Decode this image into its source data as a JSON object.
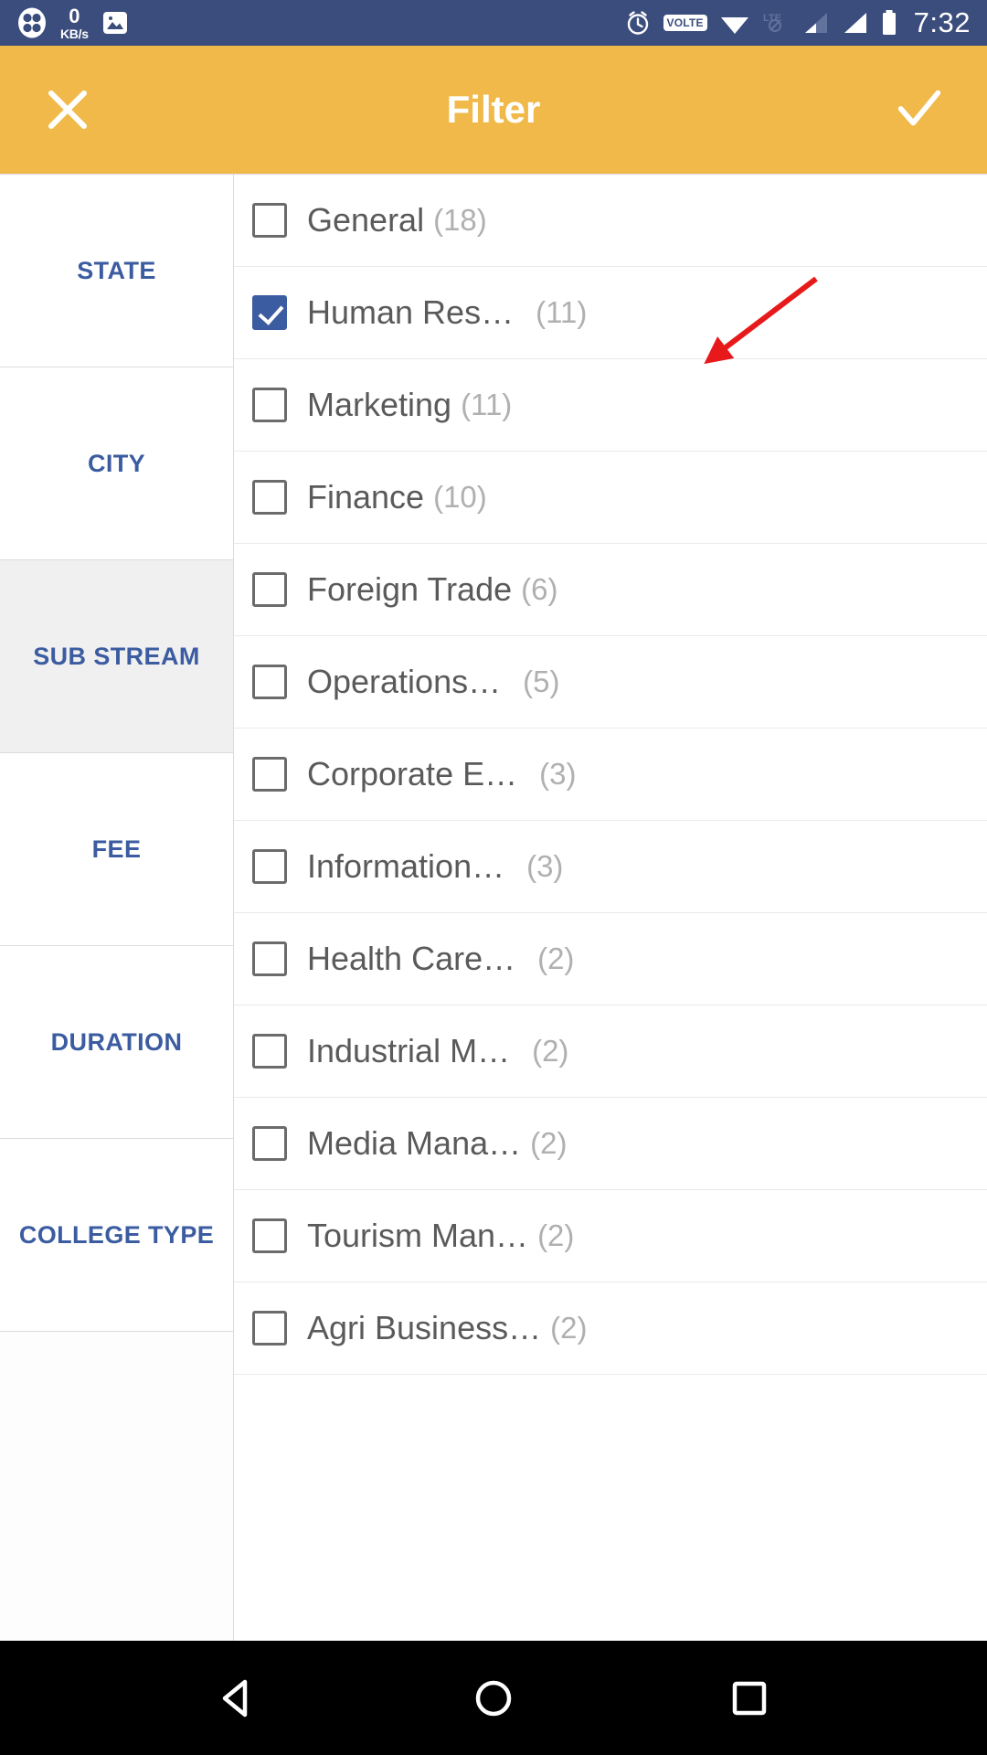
{
  "statusbar": {
    "network_speed_value": "0",
    "network_speed_unit": "KB/s",
    "volte_label": "VOLTE",
    "lte_label": "LTE",
    "time": "7:32",
    "icons": [
      "clover-icon",
      "image-icon",
      "alarm-icon",
      "volte-icon",
      "wifi-icon",
      "lte-disabled-icon",
      "signal-icon-1",
      "signal-icon-2",
      "battery-icon"
    ]
  },
  "appbar": {
    "title": "Filter",
    "close_label": "Close",
    "apply_label": "Apply",
    "background_color": "#f0b94a"
  },
  "sidebar": {
    "selected_index": 2,
    "items": [
      {
        "label": "STATE"
      },
      {
        "label": "CITY"
      },
      {
        "label": "SUB STREAM"
      },
      {
        "label": "FEE"
      },
      {
        "label": "DURATION"
      },
      {
        "label": "COLLEGE TYPE"
      }
    ],
    "accent_color": "#3b5ca0",
    "selected_background": "#f0f0f0"
  },
  "filter_list": {
    "rows": [
      {
        "label": "General",
        "count": "(18)",
        "checked": false,
        "wide_gap": false
      },
      {
        "label": "Human Res…",
        "count": "(11)",
        "checked": true,
        "wide_gap": true
      },
      {
        "label": "Marketing",
        "count": "(11)",
        "checked": false,
        "wide_gap": false
      },
      {
        "label": "Finance",
        "count": "(10)",
        "checked": false,
        "wide_gap": false
      },
      {
        "label": "Foreign Trade",
        "count": "(6)",
        "checked": false,
        "wide_gap": false
      },
      {
        "label": "Operations…",
        "count": "(5)",
        "checked": false,
        "wide_gap": true
      },
      {
        "label": "Corporate E…",
        "count": "(3)",
        "checked": false,
        "wide_gap": true
      },
      {
        "label": "Information…",
        "count": "(3)",
        "checked": false,
        "wide_gap": true
      },
      {
        "label": "Health Care…",
        "count": "(2)",
        "checked": false,
        "wide_gap": true
      },
      {
        "label": "Industrial M…",
        "count": "(2)",
        "checked": false,
        "wide_gap": true
      },
      {
        "label": "Media Mana…",
        "count": "(2)",
        "checked": false,
        "wide_gap": false
      },
      {
        "label": "Tourism Man…",
        "count": "(2)",
        "checked": false,
        "wide_gap": false
      },
      {
        "label": "Agri Business…",
        "count": "(2)",
        "checked": false,
        "wide_gap": false
      }
    ],
    "checked_color": "#3b5ca0"
  },
  "annotation": {
    "arrow_color": "#e8191b",
    "target": "human-resources-row"
  },
  "navbar": {
    "back_label": "Back",
    "home_label": "Home",
    "recents_label": "Recents"
  }
}
